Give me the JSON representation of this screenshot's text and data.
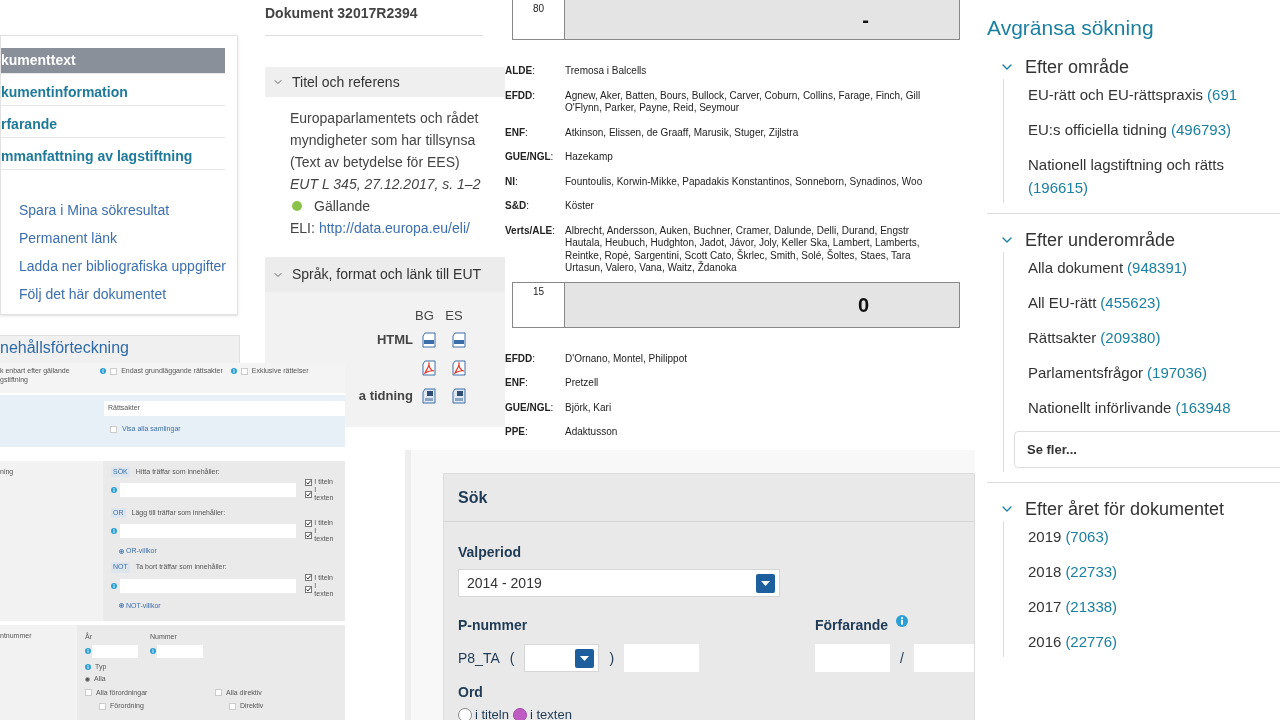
{
  "nav_card": {
    "items": [
      {
        "label": "kumenttext",
        "selected": true
      },
      {
        "label": "kumentinformation",
        "selected": false
      },
      {
        "label": "rfarande",
        "selected": false
      },
      {
        "label": "mmanfattning av lagstiftning",
        "selected": false
      }
    ],
    "links": [
      "Spara i Mina sökresultat",
      "Permanent länk",
      "Ladda ner bibliografiska uppgifter",
      "Följ det här dokumentet"
    ]
  },
  "document": {
    "title": "Dokument 32017R2394",
    "title_section": {
      "heading": "Titel och referens",
      "expanded": true,
      "lines": [
        "Europaparlamentets och rådet",
        "myndigheter som har tillsynsa",
        "(Text av betydelse för EES)"
      ],
      "citation": "EUT L 345, 27.12.2017, s. 1–2",
      "status": {
        "label": "Gällande",
        "in_force": true
      },
      "eli_label": "ELI:",
      "eli_link": "http://data.europa.eu/eli/"
    },
    "format_section": {
      "heading": "Språk, format och länk till EUT",
      "expanded": true,
      "languages": [
        "BG",
        "ES"
      ],
      "rows": [
        {
          "kind": "html",
          "label": "HTML"
        },
        {
          "kind": "pdf"
        },
        {
          "kind": "print",
          "label": "a tidning"
        }
      ]
    }
  },
  "votes": {
    "blocks": [
      {
        "count": "80",
        "result": "-",
        "groups": [
          {
            "group": "**ALDE**:",
            "lines": [
              "Tremosa i Balcells"
            ]
          },
          {
            "group": "**EFDD**:",
            "lines": [
              "Agnew, Aker, Batten, Bours, Bullock, Carver, Coburn, Collins, Farage, Finch, Gill",
              "O'Flynn, Parker, Payne, Reid, Seymour"
            ]
          },
          {
            "group": "**ENF**:",
            "lines": [
              "Atkinson, Elissen, de Graaff, Marusik, Stuger, Zijlstra"
            ]
          },
          {
            "group": "**GUE/NGL**:",
            "lines": [
              "Hazekamp"
            ]
          },
          {
            "group": "**NI**:",
            "lines": [
              "Fountoulis, Korwin-Mikke, Papadakis Konstantinos, Sonneborn, Synadinos, Woo"
            ]
          },
          {
            "group": "**S&D**:",
            "lines": [
              "Köster"
            ]
          },
          {
            "group": "**Verts/ALE**:",
            "lines": [
              "Albrecht, Andersson, Auken, Buchner, Cramer, Dalunde, Delli, Durand, Engstr",
              "Hautala, Heubuch, Hudghton, Jadot, Jávor, Joly, Keller Ska, Lambert, Lamberts,",
              "Reintke, Ropė, Sargentini, Scott Cato, Škrlec, Smith, Solé, Šoltes, Staes, Tara",
              "Urtasun, Valero, Vana, Waitz, Ždanoka"
            ]
          }
        ]
      },
      {
        "count": "15",
        "result": "0",
        "groups": [
          {
            "group": "**EFDD**:",
            "lines": [
              "D'Ornano, Montel, Philippot"
            ]
          },
          {
            "group": "**ENF**:",
            "lines": [
              "Pretzell"
            ]
          },
          {
            "group": "**GUE/NGL**:",
            "lines": [
              "Björk, Kari"
            ]
          },
          {
            "group": "**PPE**:",
            "lines": [
              "Adaktusson"
            ]
          }
        ]
      }
    ]
  },
  "refine": {
    "title": "Avgränsa sökning",
    "facets": [
      {
        "heading": "Efter område",
        "expanded": true,
        "items": [
          {
            "label": "EU-rätt och EU-rättspraxis",
            "count": "(691"
          },
          {
            "label": "EU:s officiella tidning",
            "count": "(496793)"
          },
          {
            "label": "Nationell lagstiftning och rätts",
            "count": "(196615)"
          }
        ]
      },
      {
        "heading": "Efter underområde",
        "expanded": true,
        "items": [
          {
            "label": "Alla dokument",
            "count": "(948391)"
          },
          {
            "label": "All EU-rätt",
            "count": "(455623)"
          },
          {
            "label": "Rättsakter",
            "count": "(209380)"
          },
          {
            "label": "Parlamentsfrågor",
            "count": "(197036)"
          },
          {
            "label": "Nationellt införlivande",
            "count": "(163948"
          }
        ],
        "more": "Se fler..."
      },
      {
        "heading": "Efter året för dokumentet",
        "expanded": true,
        "items": [
          {
            "label": "2019",
            "count": "(7063)"
          },
          {
            "label": "2018",
            "count": "(22733)"
          },
          {
            "label": "2017",
            "count": "(21338)"
          },
          {
            "label": "2016",
            "count": "(22776)"
          }
        ]
      }
    ]
  },
  "advanced": {
    "toc_heading": "nehållsförteckning",
    "scope_note": [
      "k enbart efter gällande",
      "gstiftning"
    ],
    "options": [
      {
        "label": "Endast grundläggande rättsakter",
        "checked": false
      },
      {
        "label": "Exklusive rättelser",
        "checked": false
      }
    ],
    "collection": {
      "value": "Rättsakter",
      "show_all": {
        "label": "Visa alla samlingar",
        "checked": false
      }
    },
    "text_search": {
      "label": "ning",
      "clauses": [
        {
          "tag": "SÖK",
          "label": "Hitta träffar som innehåller:",
          "scopes": [
            {
              "label": "I titeln",
              "checked": true
            },
            {
              "label": "I texten",
              "checked": true
            }
          ]
        },
        {
          "tag": "OR",
          "label": "Lägg till träffar som innehåller:",
          "scopes": [
            {
              "label": "I titeln",
              "checked": true
            },
            {
              "label": "I texten",
              "checked": true
            }
          ],
          "add_link": "OR-villkor"
        },
        {
          "tag": "NOT",
          "label": "Ta bort träffar som innehåller:",
          "scopes": [
            {
              "label": "I titeln",
              "checked": true
            },
            {
              "label": "I texten",
              "checked": true
            }
          ],
          "add_link": "NOT-villkor"
        }
      ]
    },
    "number": {
      "label": "ntnummer",
      "year_label": "År",
      "number_label": "Nummer",
      "type_label": "Typ",
      "types": [
        {
          "label": "Alla",
          "selected": true
        }
      ],
      "groups": [
        {
          "label": "Alla förordningar",
          "checked": false,
          "children": [
            {
              "label": "Förordning",
              "checked": false
            }
          ]
        },
        {
          "label": "Alla direktiv",
          "checked": false,
          "children": [
            {
              "label": "Direktiv",
              "checked": false
            }
          ]
        }
      ]
    }
  },
  "search_panel": {
    "heading": "Sök",
    "term": {
      "label": "Valperiod",
      "value": "2014 - 2019"
    },
    "p_number": {
      "label": "P-nummer",
      "prefix": "P8_TA",
      "open": "(",
      "close": ")"
    },
    "procedure": {
      "label": "Förfarande",
      "separator": "/"
    },
    "words": {
      "label": "Ord",
      "scopes": [
        {
          "label": "i titeln",
          "selected": false
        },
        {
          "label": "i texten",
          "selected": true
        }
      ]
    }
  }
}
